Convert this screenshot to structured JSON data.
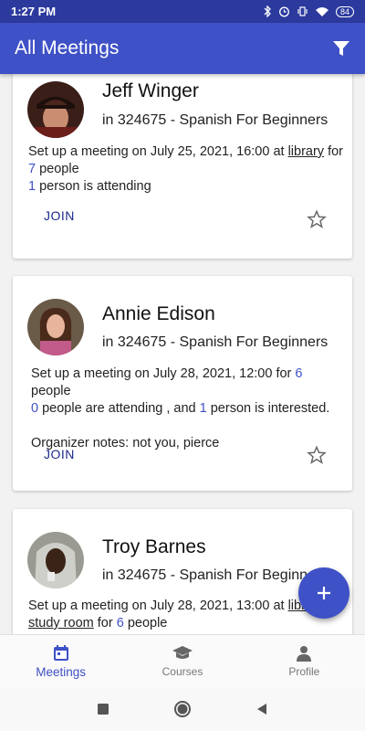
{
  "status_bar": {
    "time": "1:27 PM",
    "battery": "84"
  },
  "app_bar": {
    "title": "All Meetings",
    "filter_icon": "filter-icon"
  },
  "meetings": [
    {
      "organizer": "Jeff Winger",
      "course": "in 324675 - Spanish For Beginners",
      "line1_prefix": "Set up a meeting on July 25, 2021, 16:00 at ",
      "location": "library",
      "line1_mid": " for",
      "capacity": "7",
      "capacity_suffix": " people",
      "attending": "1",
      "attending_suffix": " person is attending",
      "join_label": "JOIN"
    },
    {
      "organizer": "Annie Edison",
      "course": "in 324675 - Spanish For Beginners",
      "line1_prefix": "Set up a meeting on July 28, 2021, 12:00 for ",
      "capacity": "6",
      "capacity_suffix": " people",
      "attending": "0",
      "attending_mid": " people are attending , and ",
      "interested": "1",
      "interested_suffix": " person is interested.",
      "notes": "Organizer notes: not you, pierce",
      "join_label": "JOIN"
    },
    {
      "organizer": "Troy Barnes",
      "course": "in 324675 - Spanish For Beginners",
      "line1_prefix": "Set up a meeting on July 28, 2021, 13:00 at ",
      "location_part1": "library",
      "location_part2": "study room",
      "line2_mid": " for ",
      "capacity": "6",
      "capacity_suffix": " people"
    }
  ],
  "bottom_nav": [
    {
      "label": "Meetings",
      "icon": "calendar-icon",
      "active": true
    },
    {
      "label": "Courses",
      "icon": "graduation-cap-icon",
      "active": false
    },
    {
      "label": "Profile",
      "icon": "person-icon",
      "active": false
    }
  ],
  "colors": {
    "primary": "#3f51c6",
    "status_bar": "#2c3a9e",
    "join": "#1d2a8a"
  }
}
